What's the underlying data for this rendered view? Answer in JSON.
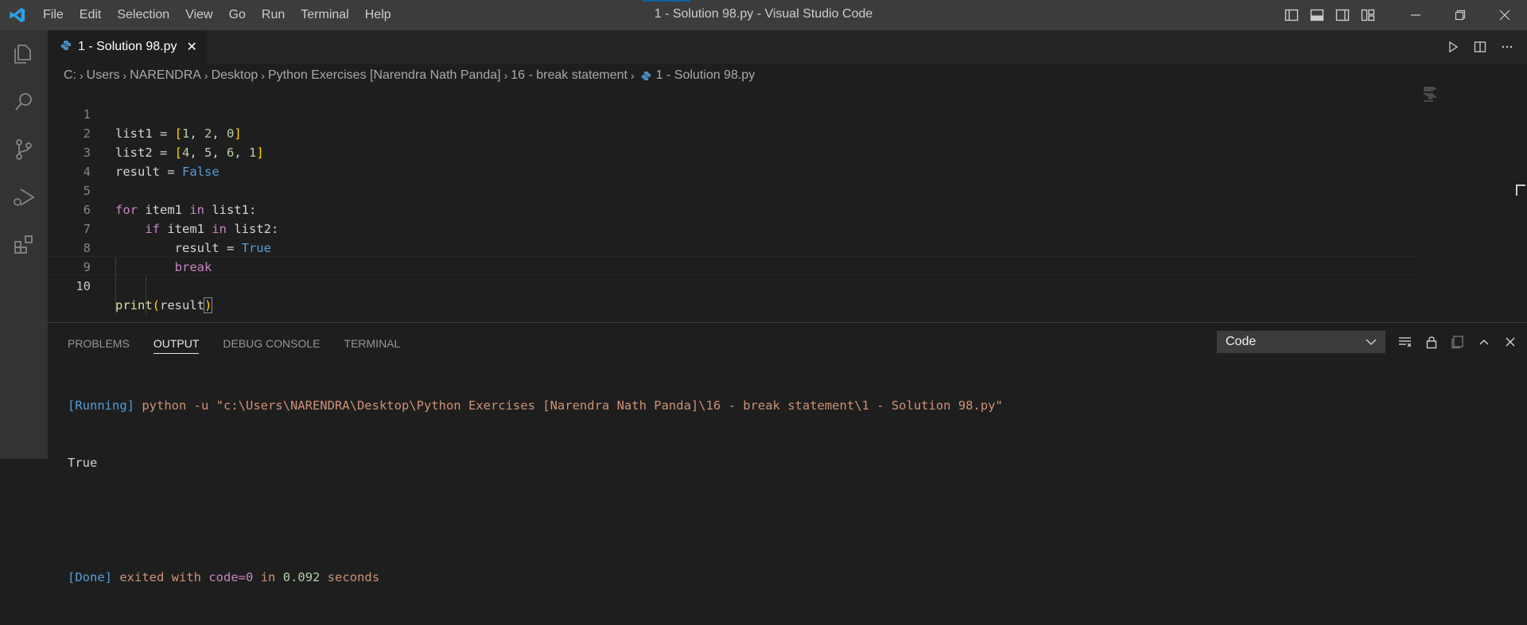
{
  "window": {
    "title": "1 - Solution 98.py - Visual Studio Code"
  },
  "menu": [
    "File",
    "Edit",
    "Selection",
    "View",
    "Go",
    "Run",
    "Terminal",
    "Help"
  ],
  "tab": {
    "label": "1 - Solution 98.py",
    "close": "✕"
  },
  "breadcrumb": [
    "C:",
    "Users",
    "NARENDRA",
    "Desktop",
    "Python Exercises [Narendra Nath Panda]",
    "16 - break statement",
    "1 - Solution 98.py"
  ],
  "editor": {
    "line_numbers": [
      "1",
      "2",
      "3",
      "4",
      "5",
      "6",
      "7",
      "8",
      "9",
      "10"
    ],
    "active_line": "10"
  },
  "panel": {
    "tabs": [
      "PROBLEMS",
      "OUTPUT",
      "DEBUG CONSOLE",
      "TERMINAL"
    ],
    "active_tab": "OUTPUT",
    "output_channel": "Code",
    "output": {
      "running_tag": "[Running]",
      "command": "python -u \"c:\\Users\\NARENDRA\\Desktop\\Python Exercises [Narendra Nath Panda]\\16 - break statement\\1 - Solution 98.py\"",
      "result": "True",
      "done_tag": "[Done]",
      "exited_text": "exited with",
      "code_text": "code=0",
      "in_text": "in",
      "duration": "0.092",
      "seconds_text": "seconds"
    }
  },
  "colors": {
    "accent": "#0e639c",
    "title_bar": "#3c3c3c",
    "activity_bar": "#333333",
    "editor_bg": "#1e1e1e"
  },
  "icons": {
    "logo": "vscode-logo-icon",
    "activity": [
      "explorer-icon",
      "search-icon",
      "source-control-icon",
      "run-debug-icon",
      "extensions-icon"
    ],
    "editor_actions": [
      "run-icon",
      "split-editor-icon",
      "more-actions-icon"
    ],
    "panel_actions": [
      "clear-output-icon",
      "lock-icon",
      "open-editor-icon",
      "maximize-panel-icon",
      "close-panel-icon"
    ]
  }
}
